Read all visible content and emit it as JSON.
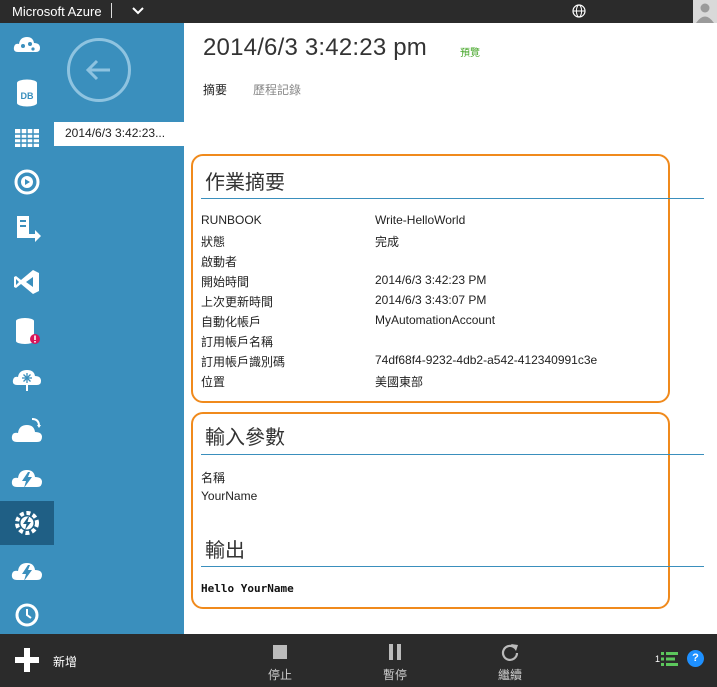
{
  "topbar": {
    "brand": "Microsoft Azure"
  },
  "col2": {
    "selected_item": "2014/6/3 3:42:23..."
  },
  "header": {
    "title": "2014/6/3 3:42:23 pm",
    "preview_badge": "預覽",
    "tabs": [
      {
        "label": "摘要",
        "active": true
      },
      {
        "label": "歷程記錄",
        "active": false
      }
    ]
  },
  "job_summary": {
    "title": "作業摘要",
    "rows": [
      {
        "key": "RUNBOOK",
        "value": "Write-HelloWorld"
      },
      {
        "key": "狀態",
        "value": "完成"
      },
      {
        "key": "啟動者",
        "value": ""
      },
      {
        "key": "開始時間",
        "value": "2014/6/3 3:42:23 PM"
      },
      {
        "key": "上次更新時間",
        "value": "2014/6/3 3:43:07 PM"
      },
      {
        "key": "自動化帳戶",
        "value": "MyAutomationAccount"
      },
      {
        "key": "訂用帳戶名稱",
        "value": ""
      },
      {
        "key": "訂用帳戶識別碼",
        "value": "74df68f4-9232-4db2-a542-412340991c3e"
      },
      {
        "key": "位置",
        "value": "美國東部"
      }
    ]
  },
  "input_params": {
    "title": "輸入參數",
    "name_header": "名稱",
    "names": [
      "YourName"
    ]
  },
  "output": {
    "title": "輸出",
    "text": "Hello YourName"
  },
  "cmdbar": {
    "new_label": "新增",
    "stop_label": "停止",
    "pause_label": "暫停",
    "resume_label": "繼續",
    "count": "1",
    "help_label": "?"
  },
  "colors": {
    "nav_blue": "#3a8fbd",
    "nav_active": "#1f5f85",
    "bar_dark": "#2b2b2b",
    "highlight_orange": "#f08a1c",
    "preview_green": "#4aa82e"
  },
  "icons": {
    "nav": [
      "cloud-services-icon",
      "sql-database-icon",
      "storage-table-icon",
      "media-services-icon",
      "service-bus-icon",
      "visual-studio-online-icon",
      "cache-icon",
      "biztalk-services-icon",
      "recovery-services-icon",
      "automation-cloud-icon",
      "automation-icon",
      "scheduler-icon",
      "history-icon"
    ]
  }
}
